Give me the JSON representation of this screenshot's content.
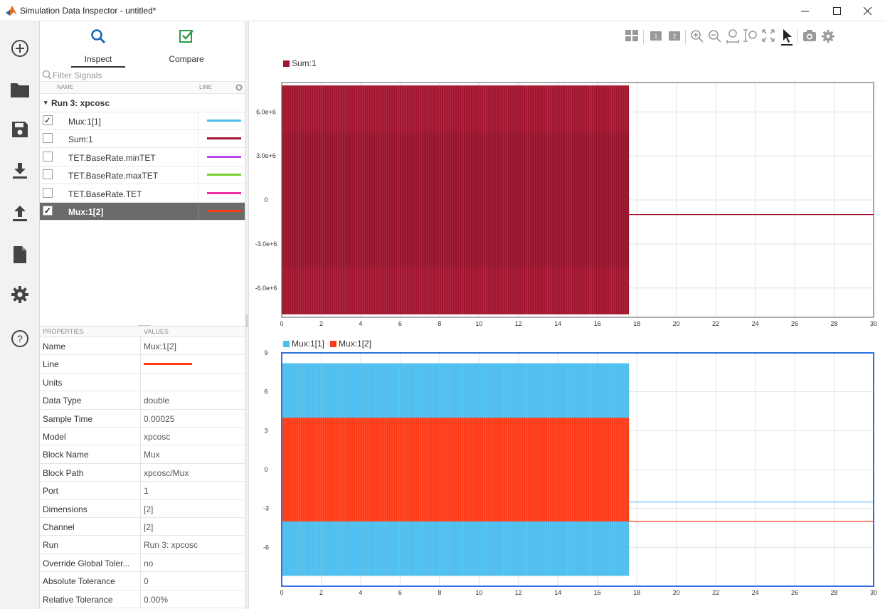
{
  "window": {
    "title": "Simulation Data Inspector - untitled*",
    "controls": [
      "minimize",
      "maximize",
      "close"
    ]
  },
  "rail": {
    "icons": [
      "new-session-icon",
      "open-folder-icon",
      "save-icon",
      "import-icon",
      "export-icon",
      "report-icon",
      "settings-icon",
      "help-icon"
    ]
  },
  "tabs": {
    "inspect": "Inspect",
    "compare": "Compare"
  },
  "filter": {
    "placeholder": "Filter Signals"
  },
  "signal_table": {
    "col_name": "NAME",
    "col_line": "LINE",
    "run": "Run 3: xpcosc",
    "signals": [
      {
        "name": "Mux:1[1]",
        "checked": true,
        "color": "#4dbeee",
        "selected": false
      },
      {
        "name": "Sum:1",
        "checked": false,
        "color": "#a2142f",
        "selected": false
      },
      {
        "name": "TET.BaseRate.minTET",
        "checked": false,
        "color": "#b44be8",
        "selected": false
      },
      {
        "name": "TET.BaseRate.maxTET",
        "checked": false,
        "color": "#77d12a",
        "selected": false
      },
      {
        "name": "TET.BaseRate.TET",
        "checked": false,
        "color": "#ee2ea4",
        "selected": false
      },
      {
        "name": "Mux:1[2]",
        "checked": true,
        "color": "#ff3b17",
        "selected": true
      }
    ]
  },
  "properties": {
    "col_props": "PROPERTIES",
    "col_values": "VALUES",
    "rows": [
      {
        "key": "Name",
        "value": "Mux:1[2]"
      },
      {
        "key": "Line",
        "value": "",
        "line_color": "#ff3b17"
      },
      {
        "key": "Units",
        "value": ""
      },
      {
        "key": "Data Type",
        "value": "double"
      },
      {
        "key": "Sample Time",
        "value": "0.00025"
      },
      {
        "key": "Model",
        "value": "xpcosc"
      },
      {
        "key": "Block Name",
        "value": "Mux"
      },
      {
        "key": "Block Path",
        "value": "xpcosc/Mux"
      },
      {
        "key": "Port",
        "value": "1"
      },
      {
        "key": "Dimensions",
        "value": "[2]"
      },
      {
        "key": "Channel",
        "value": "[2]"
      },
      {
        "key": "Run",
        "value": "Run 3: xpcosc"
      },
      {
        "key": "Override Global Toler...",
        "value": "no"
      },
      {
        "key": "Absolute Tolerance",
        "value": "0"
      },
      {
        "key": "Relative Tolerance",
        "value": "0.00%"
      }
    ]
  },
  "toolbar": {
    "icons": [
      "layout-grid-icon",
      "subplot-1-icon",
      "subplot-2-icon",
      "zoom-in-icon",
      "zoom-out-icon",
      "zoom-x-icon",
      "zoom-y-icon",
      "fit-to-view-icon",
      "cursor-icon",
      "snapshot-icon",
      "plot-settings-icon"
    ]
  },
  "chart_data": [
    {
      "type": "line",
      "title": "",
      "xlabel": "",
      "ylabel": "",
      "xlim": [
        0,
        30
      ],
      "ylim": [
        -8000000.0,
        8000000.0
      ],
      "xticks": [
        "0",
        "2",
        "4",
        "6",
        "8",
        "10",
        "12",
        "14",
        "16",
        "18",
        "20",
        "22",
        "24",
        "26",
        "28",
        "30"
      ],
      "yticks": [
        "6.0e+6",
        "3.0e+6",
        "0",
        "-3.0e+6",
        "-6.0e+6"
      ],
      "ytick_values": [
        6000000.0,
        3000000.0,
        0,
        -3000000.0,
        -6000000.0
      ],
      "grid": true,
      "legend_position": "top-left",
      "series": [
        {
          "name": "Sum:1",
          "color": "#a2142f",
          "oscillation_end_x": 17.6,
          "envelope_max": 7800000.0,
          "envelope_min": -7800000.0,
          "inner_band_max": 4600000.0,
          "inner_band_min": -4600000.0,
          "steady_value": -1000000.0
        }
      ]
    },
    {
      "type": "line",
      "title": "",
      "xlabel": "",
      "ylabel": "",
      "xlim": [
        0,
        30
      ],
      "ylim": [
        -9,
        9
      ],
      "xticks": [
        "0",
        "2",
        "4",
        "6",
        "8",
        "10",
        "12",
        "14",
        "16",
        "18",
        "20",
        "22",
        "24",
        "26",
        "28",
        "30"
      ],
      "yticks": [
        "9",
        "6",
        "3",
        "0",
        "-3",
        "-6"
      ],
      "ytick_values": [
        9,
        6,
        3,
        0,
        -3,
        -6
      ],
      "grid": true,
      "legend_position": "top-left",
      "selected": true,
      "series": [
        {
          "name": "Mux:1[1]",
          "color": "#4dbeee",
          "oscillation_end_x": 17.6,
          "envelope_max": 8.2,
          "envelope_min": -8.2,
          "steady_value": -2.5
        },
        {
          "name": "Mux:1[2]",
          "color": "#ff3b17",
          "oscillation_end_x": 17.6,
          "envelope_max": 4.0,
          "envelope_min": -4.0,
          "steady_value": -4.0
        }
      ]
    }
  ]
}
